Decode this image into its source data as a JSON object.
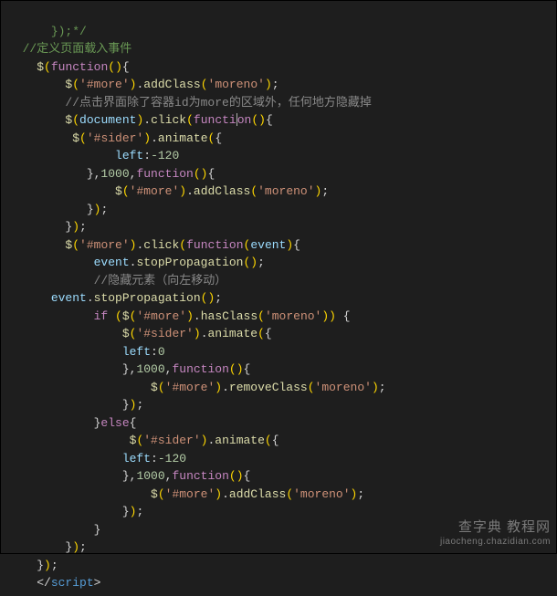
{
  "code": {
    "l1a": "});*/",
    "l2": "//定义页面载入事件",
    "l3_dollar": "$",
    "l3_kw": "function",
    "l4_dollar": "$",
    "l4_str1": "'#more'",
    "l4_call1": "addClass",
    "l4_str2": "'moreno'",
    "l5": "//点击界面除了容器id为more的区域外，任何地方隐藏掉",
    "l6_dollar": "$",
    "l6_doc": "document",
    "l6_call": "click",
    "l6_kw": "functi",
    "l6_kw2": "on",
    "l7_dollar": "$",
    "l7_str": "'#sider'",
    "l7_call": "animate",
    "l8_prop": "left",
    "l8_num": "-120",
    "l9_num": "1000",
    "l9_kw": "function",
    "l10_dollar": "$",
    "l10_str": "'#more'",
    "l10_call": "addClass",
    "l10_str2": "'moreno'",
    "l14_dollar": "$",
    "l14_str": "'#more'",
    "l14_call": "click",
    "l14_kw": "function",
    "l14_ev": "event",
    "l15_ev": "event",
    "l15_call": "stopPropagation",
    "l16": "//隐藏元素（向左移动）",
    "l17_ev": "event",
    "l17_call": "stopPropagation",
    "l18_if": "if",
    "l18_dollar": "$",
    "l18_str": "'#more'",
    "l18_has": "hasClass",
    "l18_str2": "'moreno'",
    "l19_dollar": "$",
    "l19_str": "'#sider'",
    "l19_call": "animate",
    "l20_prop": "left",
    "l20_num": "0",
    "l21_num": "1000",
    "l21_kw": "function",
    "l22_dollar": "$",
    "l22_str": "'#more'",
    "l22_call": "removeClass",
    "l22_str2": "'moreno'",
    "l24_else": "else",
    "l25_dollar": "$",
    "l25_str": "'#sider'",
    "l25_call": "animate",
    "l26_prop": "left",
    "l26_num": "-120",
    "l27_num": "1000",
    "l27_kw": "function",
    "l28_dollar": "$",
    "l28_str": "'#more'",
    "l28_call": "addClass",
    "l28_str2": "'moreno'",
    "l33_tag": "script"
  },
  "watermark": {
    "line1": "查字典 教程网",
    "line2": "jiaocheng.chazidian.com"
  }
}
